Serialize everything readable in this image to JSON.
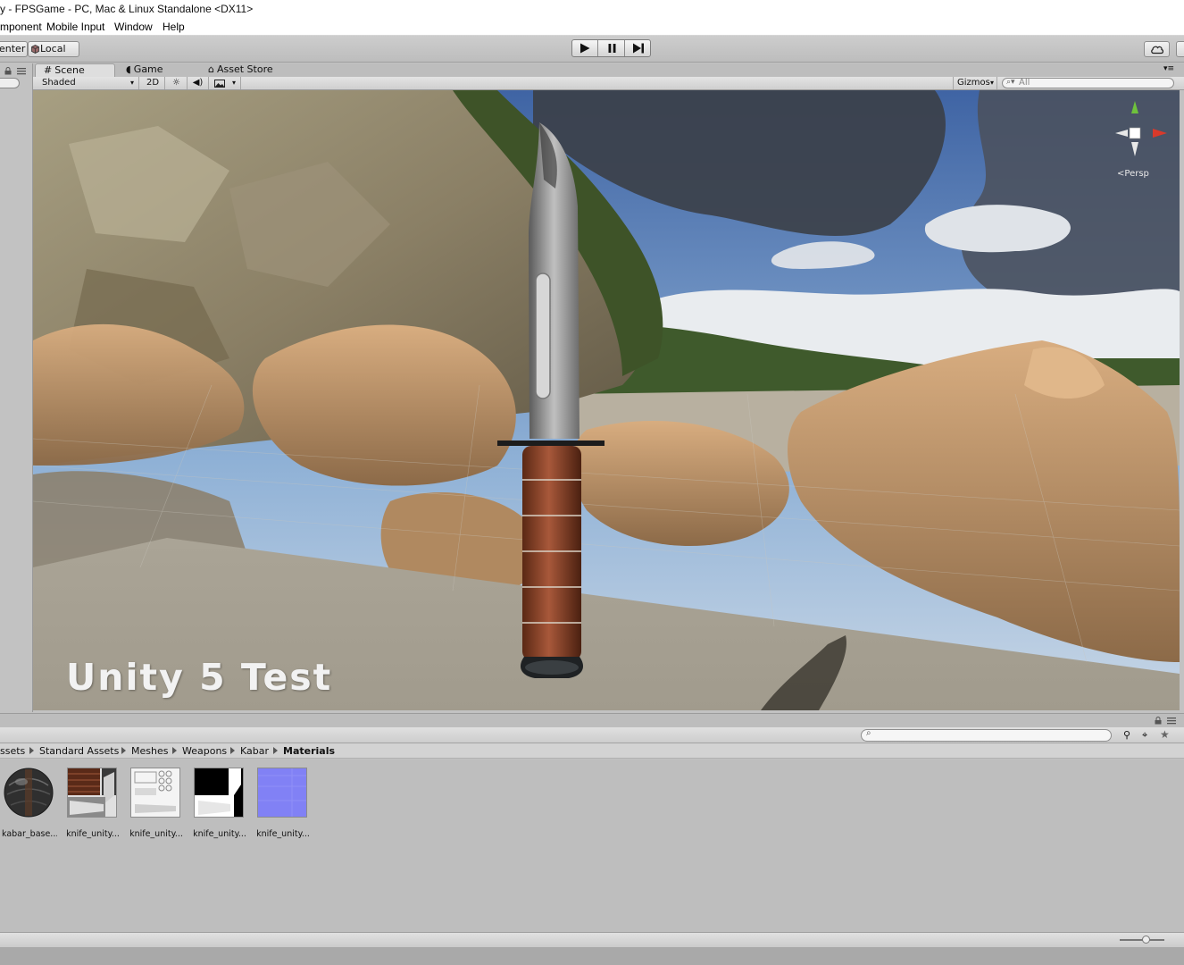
{
  "window": {
    "title": "y - FPSGame - PC, Mac & Linux Standalone <DX11>"
  },
  "menu": {
    "items": [
      "mponent",
      "Mobile Input",
      "Window",
      "Help"
    ]
  },
  "toolbar": {
    "center_label": "enter",
    "local_label": "Local"
  },
  "scene_tabs": [
    "Scene",
    "Game",
    "Asset Store"
  ],
  "scene_toolbar": {
    "shading": "Shaded",
    "mode_2d": "2D",
    "gizmos": "Gizmos",
    "search_placeholder": "All"
  },
  "viewport": {
    "overlay_text": "Unity 5 Test",
    "projection": "Persp"
  },
  "breadcrumb": [
    "ssets",
    "Standard Assets",
    "Meshes",
    "Weapons",
    "Kabar",
    "Materials"
  ],
  "assets": [
    {
      "label": "kabar_base..."
    },
    {
      "label": "knife_unity..."
    },
    {
      "label": "knife_unity..."
    },
    {
      "label": "knife_unity..."
    },
    {
      "label": "knife_unity..."
    }
  ],
  "colors": {
    "accent_gizmo_x": "#d93a2b",
    "accent_gizmo_y": "#6fc23c",
    "normal_map": "#8181f5"
  }
}
